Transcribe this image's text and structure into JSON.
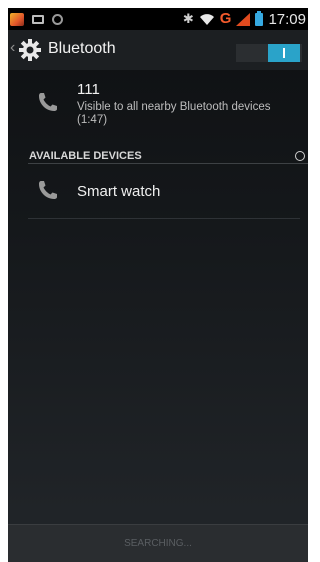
{
  "status_bar": {
    "time": "17:09",
    "network_type": "G",
    "icons": [
      "gallery-icon",
      "message-icon",
      "circle-icon",
      "bluetooth-icon",
      "wifi-icon",
      "signal-icon",
      "battery-icon"
    ]
  },
  "action_bar": {
    "title": "Bluetooth",
    "toggle_state": "on"
  },
  "this_device": {
    "name": "111",
    "visibility": "Visible to all nearby Bluetooth devices",
    "timeout": "(1:47)"
  },
  "available_section": {
    "header": "AVAILABLE DEVICES",
    "devices": [
      {
        "name": "Smart watch"
      }
    ]
  },
  "bottom_action": {
    "label": "SEARCHING..."
  },
  "colors": {
    "accent": "#2aa3c9",
    "network_g": "#f25a2c",
    "battery": "#36a9e1"
  }
}
